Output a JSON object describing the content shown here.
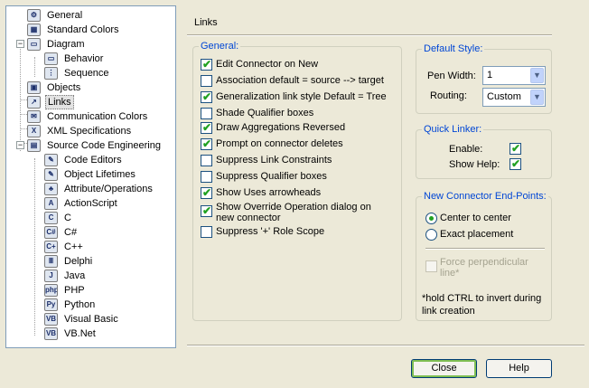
{
  "tree": {
    "items": [
      {
        "label": "General",
        "icon": "settings-icon",
        "glyph": "⚙"
      },
      {
        "label": "Standard Colors",
        "icon": "palette-icon",
        "glyph": "▦"
      },
      {
        "label": "Diagram",
        "icon": "diagram-icon",
        "glyph": "▭"
      },
      {
        "label": "Behavior",
        "icon": "diagram-behavior-icon",
        "glyph": "▭"
      },
      {
        "label": "Sequence",
        "icon": "sequence-icon",
        "glyph": "⋮"
      },
      {
        "label": "Objects",
        "icon": "objects-icon",
        "glyph": "▣"
      },
      {
        "label": "Links",
        "icon": "links-icon",
        "glyph": "↗"
      },
      {
        "label": "Communication Colors",
        "icon": "communication-icon",
        "glyph": "✉"
      },
      {
        "label": "XML Specifications",
        "icon": "xml-icon",
        "glyph": "X"
      },
      {
        "label": "Source Code Engineering",
        "icon": "source-code-icon",
        "glyph": "▤"
      },
      {
        "label": "Code Editors",
        "icon": "code-editor-icon",
        "glyph": "✎"
      },
      {
        "label": "Object Lifetimes",
        "icon": "object-lifetimes-icon",
        "glyph": "✎"
      },
      {
        "label": "Attribute/Operations",
        "icon": "attribute-operations-icon",
        "glyph": "♣"
      },
      {
        "label": "ActionScript",
        "icon": "actionscript-icon",
        "glyph": "A"
      },
      {
        "label": "C",
        "icon": "c-language-icon",
        "glyph": "C"
      },
      {
        "label": "C#",
        "icon": "csharp-icon",
        "glyph": "C#"
      },
      {
        "label": "C++",
        "icon": "cpp-icon",
        "glyph": "C+"
      },
      {
        "label": "Delphi",
        "icon": "delphi-icon",
        "glyph": "Ⅲ"
      },
      {
        "label": "Java",
        "icon": "java-icon",
        "glyph": "J"
      },
      {
        "label": "PHP",
        "icon": "php-icon",
        "glyph": "php"
      },
      {
        "label": "Python",
        "icon": "python-icon",
        "glyph": "Py"
      },
      {
        "label": "Visual Basic",
        "icon": "visual-basic-icon",
        "glyph": "VB"
      },
      {
        "label": "VB.Net",
        "icon": "vbnet-icon",
        "glyph": "VB"
      }
    ],
    "expanders": [
      "−",
      "−",
      "−"
    ]
  },
  "page": {
    "title": "Links"
  },
  "general": {
    "legend": "General:",
    "options": [
      {
        "label": "Edit Connector on New",
        "checked": true
      },
      {
        "label": "Association default = source --> target",
        "checked": false
      },
      {
        "label": "Generalization link style Default = Tree",
        "checked": true
      },
      {
        "label": "Shade Qualifier boxes",
        "checked": false
      },
      {
        "label": "Draw Aggregations Reversed",
        "checked": true
      },
      {
        "label": "Prompt on connector deletes",
        "checked": true
      },
      {
        "label": "Suppress Link Constraints",
        "checked": false
      },
      {
        "label": "Suppress Qualifier boxes",
        "checked": false
      },
      {
        "label": "Show Uses arrowheads",
        "checked": true
      },
      {
        "label": "Show Override Operation dialog on",
        "label2": "new connector",
        "checked": true
      },
      {
        "label": "Suppress '+' Role Scope",
        "checked": false
      }
    ]
  },
  "default_style": {
    "legend": "Default Style:",
    "pen_width_label": "Pen Width:",
    "pen_width_value": "1",
    "routing_label": "Routing:",
    "routing_value": "Custom"
  },
  "quick_linker": {
    "legend": "Quick Linker:",
    "enable_label": "Enable:",
    "enable_checked": true,
    "show_help_label": "Show Help:",
    "show_help_checked": true
  },
  "endpoints": {
    "legend": "New Connector End-Points:",
    "center_label": "Center to center",
    "exact_label": "Exact placement",
    "selected": "center",
    "force_label_1": "Force perpendicular",
    "force_label_2": "line*",
    "note_1": "*hold CTRL to invert during",
    "note_2": "link creation"
  },
  "buttons": {
    "close": "Close",
    "help": "Help"
  },
  "check_glyph": "✔"
}
